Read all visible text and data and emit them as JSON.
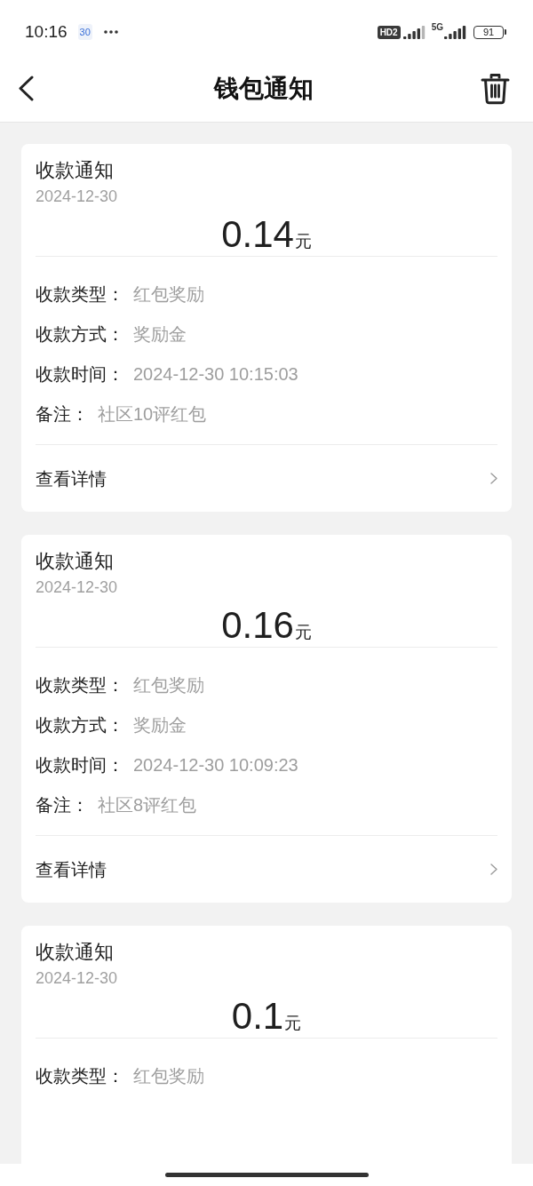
{
  "status_bar": {
    "time": "10:16",
    "calendar_day": "30",
    "hd_badge": "HD2",
    "network": "5G",
    "battery": "91"
  },
  "header": {
    "title": "钱包通知"
  },
  "notifications": [
    {
      "title": "收款通知",
      "date": "2024-12-30",
      "amount": "0.14",
      "unit": "元",
      "fields": [
        {
          "label": "收款类型：",
          "value": "红包奖励"
        },
        {
          "label": "收款方式：",
          "value": "奖励金"
        },
        {
          "label": "收款时间：",
          "value": "2024-12-30 10:15:03"
        },
        {
          "label": "备注：",
          "value": "社区10评红包"
        }
      ],
      "link": "查看详情"
    },
    {
      "title": "收款通知",
      "date": "2024-12-30",
      "amount": "0.16",
      "unit": "元",
      "fields": [
        {
          "label": "收款类型：",
          "value": "红包奖励"
        },
        {
          "label": "收款方式：",
          "value": "奖励金"
        },
        {
          "label": "收款时间：",
          "value": "2024-12-30 10:09:23"
        },
        {
          "label": "备注：",
          "value": "社区8评红包"
        }
      ],
      "link": "查看详情"
    },
    {
      "title": "收款通知",
      "date": "2024-12-30",
      "amount": "0.1",
      "unit": "元",
      "fields": [
        {
          "label": "收款类型：",
          "value": "红包奖励"
        }
      ]
    }
  ]
}
